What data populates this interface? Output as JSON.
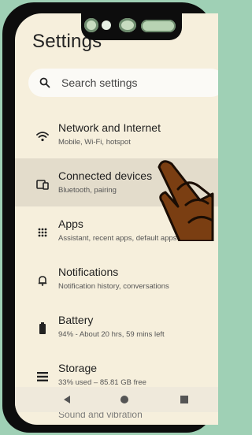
{
  "header": {
    "title": "Settings"
  },
  "search": {
    "placeholder": "Search settings"
  },
  "items": [
    {
      "label": "Network and Internet",
      "sub": "Mobile, Wi-Fi, hotspot",
      "icon": "wifi-icon"
    },
    {
      "label": "Connected devices",
      "sub": "Bluetooth, pairing",
      "icon": "connected-devices-icon"
    },
    {
      "label": "Apps",
      "sub": "Assistant, recent apps, default apps",
      "icon": "apps-grid-icon"
    },
    {
      "label": "Notifications",
      "sub": "Notification history, conversations",
      "icon": "bell-icon"
    },
    {
      "label": "Battery",
      "sub": "94% - About 20 hrs, 59 mins left",
      "icon": "battery-icon"
    },
    {
      "label": "Storage",
      "sub": "33% used – 85.81 GB free",
      "icon": "storage-icon"
    }
  ],
  "partial_item": {
    "label": "Sound and vibration"
  },
  "navbar": {
    "back": "back-icon",
    "home": "home-icon",
    "recents": "recents-icon"
  },
  "colors": {
    "background": "#f6efdc",
    "highlight": "#e3dccb",
    "frame": "#0d0d0d"
  }
}
